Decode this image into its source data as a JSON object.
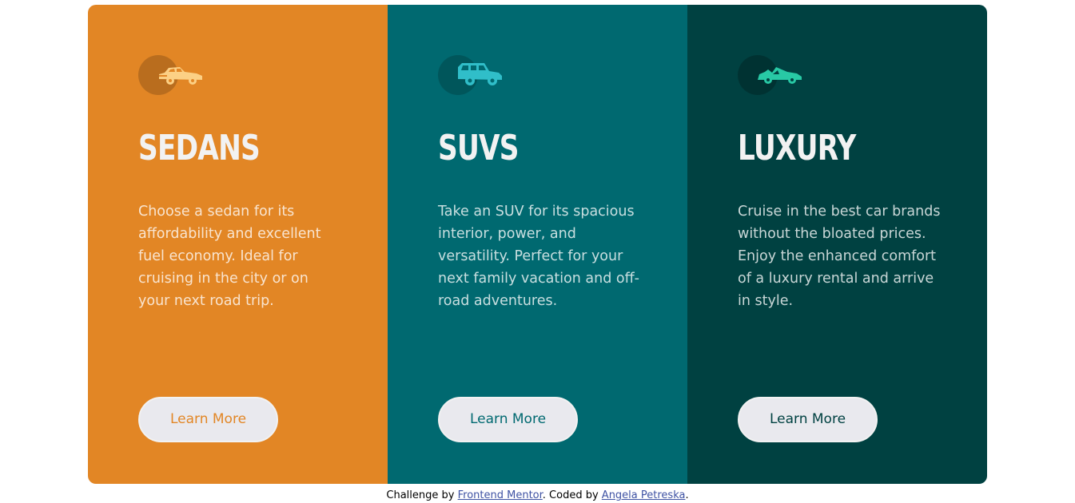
{
  "cards": [
    {
      "title": "SEDANS",
      "text": "Choose a sedan for its affordability and excellent fuel economy. Ideal for cruising in the city or on your next road trip.",
      "button_label": "Learn More",
      "icon": "sedan-car-icon",
      "bg_color": "#e28625",
      "accent_color": "#fcd085",
      "button_text_color": "#e28625"
    },
    {
      "title": "SUVS",
      "text": "Take an SUV for its spacious interior, power, and versatility. Perfect for your next family vacation and off-road adventures.",
      "button_label": "Learn More",
      "icon": "suv-car-icon",
      "bg_color": "#006970",
      "accent_color": "#30bec9",
      "button_text_color": "#006970"
    },
    {
      "title": "LUXURY",
      "text": "Cruise in the best car brands without the bloated prices. Enjoy the enhanced comfort of a luxury rental and arrive in style.",
      "button_label": "Learn More",
      "icon": "luxury-car-icon",
      "bg_color": "#004141",
      "accent_color": "#28c9a5",
      "button_text_color": "#004141"
    }
  ],
  "footer": {
    "prefix": "Challenge by ",
    "link1": "Frontend Mentor",
    "middle": ". Coded by ",
    "link2": "Angela Petreska",
    "suffix": "."
  }
}
